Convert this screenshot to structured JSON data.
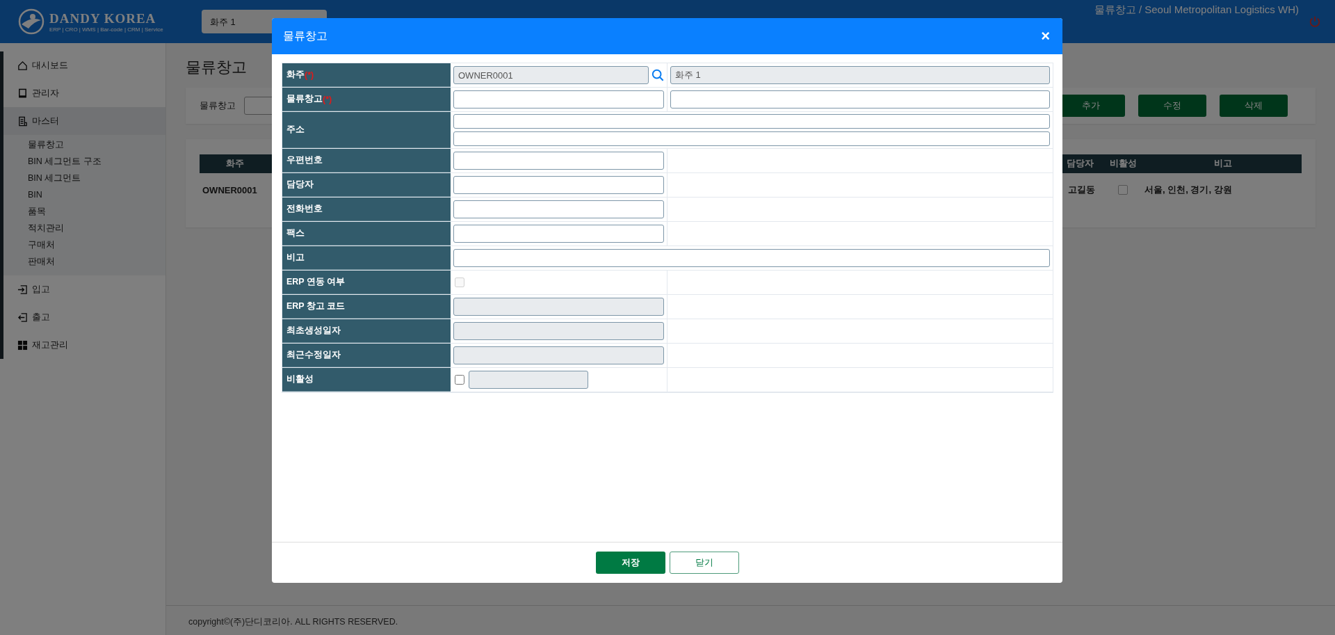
{
  "header": {
    "logo": {
      "name": "DANDY KOREA",
      "tagline": "ERP | CRO | WMS | Bar-code | CRM | Service"
    },
    "owner_select": "화주 1",
    "user_info": "물류창고 / Seoul Metropolitan Logistics WH)"
  },
  "sidebar": {
    "items": [
      {
        "label": "대시보드",
        "expanded": false
      },
      {
        "label": "관리자",
        "expanded": false
      },
      {
        "label": "마스터",
        "expanded": true,
        "children": [
          {
            "label": "물류창고"
          },
          {
            "label": "BIN 세그먼트 구조"
          },
          {
            "label": "BIN 세그먼트"
          },
          {
            "label": "BIN"
          },
          {
            "label": "품목"
          },
          {
            "label": "적치관리"
          },
          {
            "label": "구매처"
          },
          {
            "label": "판매처"
          }
        ]
      },
      {
        "label": "입고",
        "expanded": false
      },
      {
        "label": "출고",
        "expanded": false
      },
      {
        "label": "재고관리",
        "expanded": false
      }
    ]
  },
  "page": {
    "title": "물류창고",
    "search_label": "물류창고",
    "buttons": [
      "추가",
      "수정",
      "삭제"
    ],
    "table": {
      "columns": [
        "화주",
        "담당자",
        "비활성",
        "비고"
      ],
      "rows": [
        {
          "cells": [
            "OWNER0001",
            "고길동",
            "",
            "서울, 인천, 경기, 강원"
          ],
          "inactive": false
        }
      ]
    }
  },
  "modal": {
    "title": "물류창고",
    "close": "×",
    "fields": [
      {
        "kind": "lookup",
        "label": "화주",
        "required_mark": "(*)",
        "value": "OWNER0001",
        "name_value": "화주 1"
      },
      {
        "kind": "pair",
        "label": "물류창고",
        "required_mark": "(*)"
      },
      {
        "kind": "address",
        "label": "주소"
      },
      {
        "kind": "text",
        "label": "우편번호"
      },
      {
        "kind": "text",
        "label": "담당자"
      },
      {
        "kind": "text",
        "label": "전화번호"
      },
      {
        "kind": "text",
        "label": "팩스"
      },
      {
        "kind": "wide",
        "label": "비고"
      },
      {
        "kind": "check",
        "label": "ERP 연동 여부",
        "checked": false,
        "disabled": true
      },
      {
        "kind": "readonly",
        "label": "ERP 창고 코드"
      },
      {
        "kind": "readonly",
        "label": "최초생성일자"
      },
      {
        "kind": "readonly",
        "label": "최근수정일자"
      },
      {
        "kind": "check_field",
        "label": "비활성",
        "checked": false,
        "disabled": false
      }
    ],
    "buttons": [
      {
        "label": "저장",
        "kind": "primary"
      },
      {
        "label": "닫기",
        "kind": "secondary"
      }
    ]
  },
  "footer": "copyright©(주)단디코리아. ALL RIGHTS RESERVED."
}
